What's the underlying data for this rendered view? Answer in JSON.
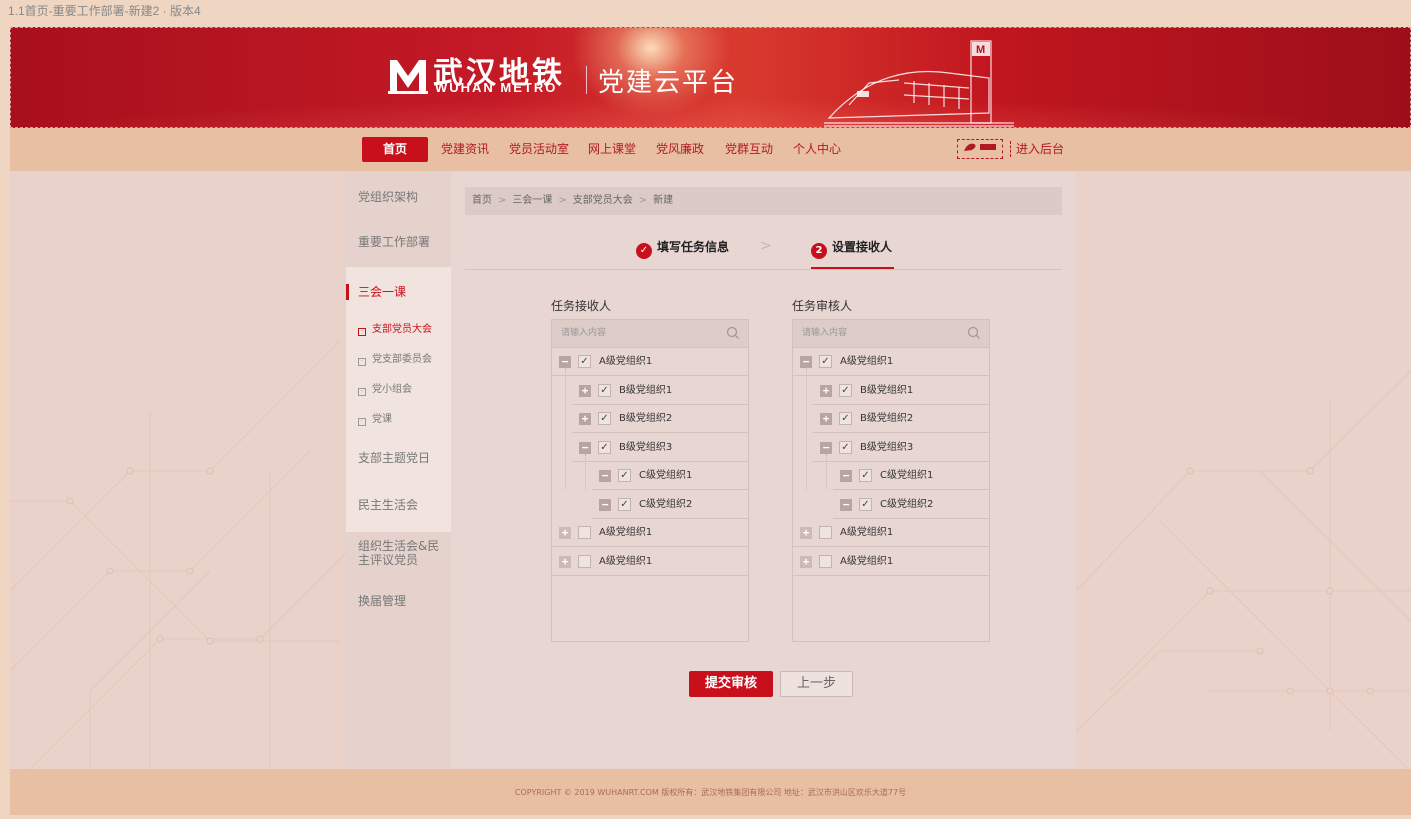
{
  "page_label": "1.1首页-重要工作部署-新建2 · 版本4",
  "banner": {
    "brand_cn": "武汉地铁",
    "brand_en": "WUHAN METRO",
    "platform": "党建云平台"
  },
  "nav": {
    "items": [
      "首页",
      "党建资讯",
      "党员活动室",
      "网上课堂",
      "党风廉政",
      "党群互动",
      "个人中心"
    ],
    "backend": "进入后台"
  },
  "sidebar": {
    "items": [
      "党组织架构",
      "重要工作部署",
      "三会一课",
      "支部主题党日",
      "民主生活会",
      "组织生活会&民主评议党员",
      "换届管理"
    ],
    "sub_items": [
      "支部党员大会",
      "党支部委员会",
      "党小组会",
      "党课"
    ]
  },
  "breadcrumb": [
    "首页",
    "三会一课",
    "支部党员大会",
    "新建"
  ],
  "steps": {
    "step1": "填写任务信息",
    "step2": "设置接收人",
    "step2_num": "2"
  },
  "panels": {
    "receiver_title": "任务接收人",
    "reviewer_title": "任务审核人",
    "search_placeholder": "请输入内容",
    "tree": [
      {
        "label": "A级党组织1",
        "level": 0,
        "toggle": "−",
        "checked": true
      },
      {
        "label": "B级党组织1",
        "level": 1,
        "toggle": "+",
        "checked": true
      },
      {
        "label": "B级党组织2",
        "level": 1,
        "toggle": "+",
        "checked": true
      },
      {
        "label": "B级党组织3",
        "level": 1,
        "toggle": "−",
        "checked": true
      },
      {
        "label": "C级党组织1",
        "level": 2,
        "toggle": "−",
        "checked": true
      },
      {
        "label": "C级党组织2",
        "level": 2,
        "toggle": "−",
        "checked": true
      },
      {
        "label": "A级党组织1",
        "level": 0,
        "toggle": "+",
        "checked": false
      },
      {
        "label": "A级党组织1",
        "level": 0,
        "toggle": "+",
        "checked": false
      }
    ]
  },
  "buttons": {
    "submit": "提交审核",
    "prev": "上一步"
  },
  "footer": "COPYRIGHT © 2019 WUHANRT.COM 版权所有：武汉地铁集团有限公司 地址：武汉市洪山区欢乐大道77号",
  "colors": {
    "accent": "#c8101c",
    "banner": "#b5131f",
    "nav_bg": "#e8bfa3"
  }
}
